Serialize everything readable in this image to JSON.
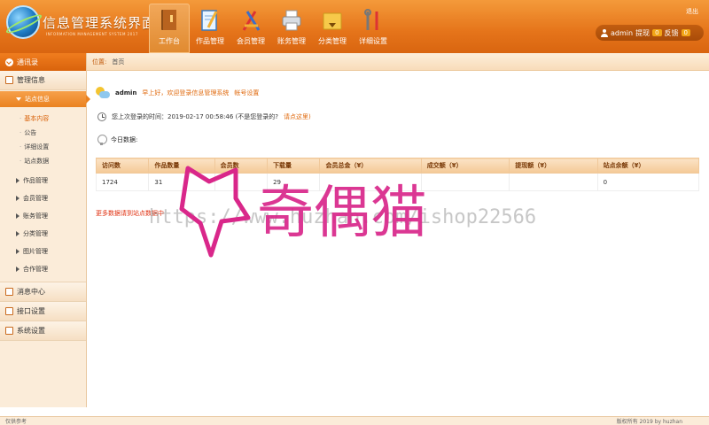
{
  "header": {
    "title": "信息管理系统界面",
    "subtitle": "INFORMATION MANAGEMENT SYSTEM 2017",
    "logout": "退出",
    "nav": [
      {
        "label": "工作台",
        "icon": "book-icon",
        "active": true
      },
      {
        "label": "作品管理",
        "icon": "notebook-pen-icon",
        "active": false
      },
      {
        "label": "会员管理",
        "icon": "pencil-ruler-icon",
        "active": false
      },
      {
        "label": "账务管理",
        "icon": "printer-icon",
        "active": false
      },
      {
        "label": "分类管理",
        "icon": "folder-download-icon",
        "active": false
      },
      {
        "label": "详细设置",
        "icon": "tools-icon",
        "active": false
      }
    ],
    "user": {
      "name": "admin",
      "withdraw_label": "提现",
      "withdraw_count": "0",
      "feedback_label": "反馈",
      "feedback_count": "0"
    }
  },
  "sidebar": {
    "top": "通讯录",
    "sections": [
      {
        "label": "管理信息"
      },
      {
        "label": "消息中心"
      },
      {
        "label": "接口设置"
      },
      {
        "label": "系统设置"
      }
    ],
    "active_sub": "站点信息",
    "leaves": [
      "基本内容",
      "公告",
      "详细设置",
      "站点数据"
    ],
    "groups": [
      "作品管理",
      "会员管理",
      "账务管理",
      "分类管理",
      "图片管理",
      "合作管理"
    ]
  },
  "breadcrumb": {
    "label": "位置:",
    "current": "首页"
  },
  "welcome": {
    "name": "admin",
    "message": "早上好，欢迎登录信息管理系统",
    "link": "帐号设置"
  },
  "last_login": {
    "text": "您上次登录的时间：2019-02-17 00:58:46  (不是您登录的?",
    "link": "请点这里)"
  },
  "today_label": "今日数据:",
  "table": {
    "headers": [
      "访问数",
      "作品数量",
      "会员数",
      "下载量",
      "会员总金（¥）",
      "成交额（¥）",
      "提现额（¥）",
      "站点余额（¥）"
    ],
    "rows": [
      [
        "1724",
        "31",
        "",
        "29",
        "",
        "",
        "",
        "0"
      ]
    ]
  },
  "more_link": "更多数据请到站点数据中",
  "watermark": {
    "url": "https://www.huzhan.com/ishop22566",
    "text": "奇偶猫"
  },
  "footer": {
    "left": "仅供参考",
    "right": "版权所有 2019 by huzhan"
  },
  "colors": {
    "accent": "#e5741a",
    "link": "#e06b10",
    "watermark": "#d9278a"
  }
}
